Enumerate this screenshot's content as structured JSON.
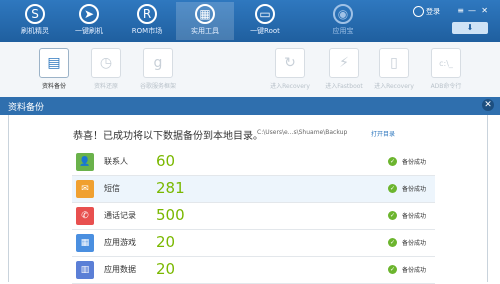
{
  "nav": {
    "items": [
      {
        "label": "刷机精灵",
        "icon": "shield-icon",
        "glyph": "S"
      },
      {
        "label": "一键刷机",
        "icon": "cursor-icon",
        "glyph": "➤"
      },
      {
        "label": "ROM市场",
        "icon": "r-icon",
        "glyph": "R"
      },
      {
        "label": "实用工具",
        "icon": "grid-icon",
        "glyph": "▦"
      },
      {
        "label": "一键Root",
        "icon": "phone-icon",
        "glyph": "▭"
      },
      {
        "label": "应用宝",
        "icon": "yyb-icon",
        "glyph": "◉"
      }
    ],
    "login_label": "登录",
    "menu_glyph": "≡",
    "minimize_glyph": "—",
    "close_glyph": "✕",
    "download_glyph": "⬇"
  },
  "toolbar": {
    "items": [
      {
        "label": "资料备份",
        "glyph": "▤"
      },
      {
        "label": "资料还原",
        "glyph": "◷"
      },
      {
        "label": "谷歌服务框架",
        "glyph": "g"
      },
      {
        "label": "进入Recovery",
        "glyph": "↻"
      },
      {
        "label": "进入Fastboot",
        "glyph": "⚡"
      },
      {
        "label": "进入Recovery",
        "glyph": "▯"
      },
      {
        "label": "ADB命令行",
        "glyph": "c:\\_"
      }
    ]
  },
  "dialog": {
    "title": "资料备份",
    "close_glyph": "✕",
    "headline": "恭喜！已成功将以下数据备份到本地目录。",
    "path": "C:\\Users\\e...s\\Shuame\\Backup",
    "open_link": "打开目录",
    "rows": [
      {
        "name": "联系人",
        "count": "60",
        "status": "备份成功",
        "icon": "contact-icon",
        "glyph": "👤",
        "color": "#6ab24b"
      },
      {
        "name": "短信",
        "count": "281",
        "status": "备份成功",
        "icon": "sms-icon",
        "glyph": "✉",
        "color": "#f0a030"
      },
      {
        "name": "通话记录",
        "count": "500",
        "status": "备份成功",
        "icon": "call-icon",
        "glyph": "✆",
        "color": "#e8504f"
      },
      {
        "name": "应用游戏",
        "count": "20",
        "status": "备份成功",
        "icon": "app-icon",
        "glyph": "▦",
        "color": "#4a8fe0"
      },
      {
        "name": "应用数据",
        "count": "20",
        "status": "备份成功",
        "icon": "appdata-icon",
        "glyph": "▥",
        "color": "#5b7fd6"
      }
    ]
  }
}
